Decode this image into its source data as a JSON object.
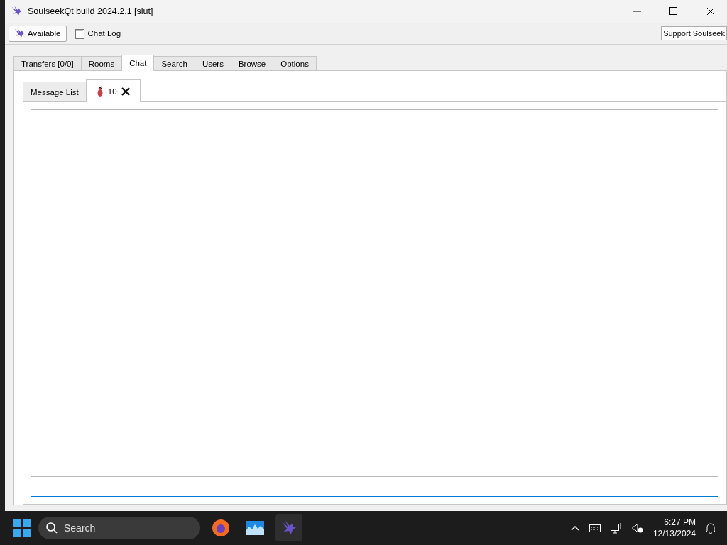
{
  "window": {
    "title": "SoulseekQt build 2024.2.1 [slut]"
  },
  "toolbar": {
    "status_button": "Available",
    "chat_log_button": "Chat Log",
    "support_button": "Support Soulseek"
  },
  "tabs": [
    {
      "label": "Transfers [0/0]",
      "selected": false
    },
    {
      "label": "Rooms",
      "selected": false
    },
    {
      "label": "Chat",
      "selected": true
    },
    {
      "label": "Search",
      "selected": false
    },
    {
      "label": "Users",
      "selected": false
    },
    {
      "label": "Browse",
      "selected": false
    },
    {
      "label": "Options",
      "selected": false
    }
  ],
  "chat_tabs": [
    {
      "label": "Message List",
      "selected": false,
      "closable": false,
      "user_icon": false
    },
    {
      "label": "10",
      "selected": true,
      "closable": true,
      "user_icon": true
    }
  ],
  "taskbar": {
    "search_placeholder": "Search",
    "time": "6:27 PM",
    "date": "12/13/2024"
  }
}
